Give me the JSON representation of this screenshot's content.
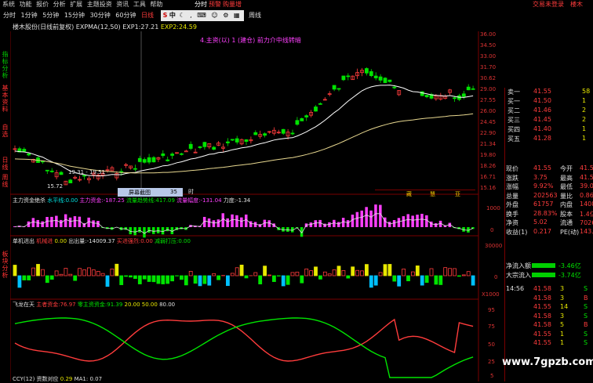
{
  "menubar": {
    "items": [
      "系统",
      "功能",
      "报价",
      "分析",
      "扩展",
      "主题投资",
      "资讯",
      "工具",
      "帮助"
    ],
    "center_items": [
      "分时",
      "预警",
      "购量增"
    ],
    "right_items": [
      "交易未登录",
      "楼木"
    ]
  },
  "toolbar": {
    "periods": [
      "分时",
      "1分钟",
      "5分钟",
      "15分钟",
      "30分钟",
      "60分钟",
      "日线",
      "周线"
    ],
    "ime": [
      "S",
      "中"
    ]
  },
  "left_tabs": [
    "指标分析",
    "基本资料",
    "自选",
    "日线",
    "周线",
    "板块分析"
  ],
  "header": {
    "title": "楼木股份(日线前复权)",
    "indicator": "EXPMA(12,50)",
    "exp1_label": "EXP1:",
    "exp1_value": "27.21",
    "exp2_label": "EXP2:",
    "exp2_value": "24.59",
    "note": "4.主资(以) 1 (建仓) 前力介中线转暗"
  },
  "price_axis": [
    "36.00",
    "34.50",
    "33.00",
    "31.70",
    "30.62",
    "29.00",
    "27.55",
    "26.00",
    "24.45",
    "22.90",
    "21.34",
    "19.80",
    "18.26",
    "16.71",
    "15.16"
  ],
  "price_labels": {
    "low": "15.72",
    "range": "19.31 - 19.51"
  },
  "tooltip": {
    "label": "屏幕截图",
    "value": "35",
    "extra": "时"
  },
  "strip_labels": [
    "藏",
    "慧",
    "亚"
  ],
  "panel2": {
    "title": "主力资金绝杀",
    "items": [
      {
        "label": "水平线:",
        "value": "0.00",
        "color": "#00e0e0"
      },
      {
        "label": "主力资金:",
        "value": "-187.25",
        "color": "#ff40ff"
      },
      {
        "label": "流量趋势线:",
        "value": "417.09",
        "color": "#00e400"
      },
      {
        "label": "流量幅度:",
        "value": "-131.04",
        "color": "#ff40ff"
      },
      {
        "label": "力度:",
        "value": "-1.34",
        "color": "#e0e0e0"
      }
    ],
    "axis": [
      "1000",
      "0"
    ]
  },
  "panel3": {
    "title": "单机进出",
    "items": [
      {
        "label": "机械进",
        "value": "",
        "color": "#ff3c3c"
      },
      {
        "label": "0.00",
        "value": "",
        "color": "#e8e800"
      },
      {
        "label": "出出量:",
        "value": "-14009.37",
        "color": "#ffffff"
      },
      {
        "label": "买进强烈:",
        "value": "0.00",
        "color": "#ff3c3c"
      },
      {
        "label": "减弱打压:",
        "value": "0.00",
        "color": "#00e400"
      }
    ],
    "axis": [
      "30000",
      "0",
      "X1000"
    ]
  },
  "panel4": {
    "title": "飞龙在天",
    "items": [
      {
        "label": "主者资金:",
        "value": "76.97",
        "color": "#ff3c3c"
      },
      {
        "label": "零主资资金:",
        "value": "91.39",
        "color": "#00e400"
      },
      {
        "label": "20.00",
        "value": "",
        "color": "#e8e800"
      },
      {
        "label": "50.00",
        "value": "",
        "color": "#e8e800"
      },
      {
        "label": "80.00",
        "value": "",
        "color": "#e0e0e0"
      }
    ],
    "axis": [
      "95",
      "75",
      "50",
      "25",
      "5"
    ]
  },
  "footer": {
    "left": "CCY(12) 资数对应",
    "v1": "0.29",
    "m1": "MA1: 0.07"
  },
  "quote": {
    "sell": [
      {
        "label": "卖一",
        "price": "41.55",
        "vol": "58"
      },
      {
        "label": "买一",
        "price": "41.50",
        "vol": "1"
      },
      {
        "label": "买二",
        "price": "41.46",
        "vol": "2"
      },
      {
        "label": "买三",
        "price": "41.45",
        "vol": "2"
      },
      {
        "label": "买四",
        "price": "41.40",
        "vol": "1"
      },
      {
        "label": "买五",
        "price": "41.28",
        "vol": "1"
      }
    ],
    "stats": [
      {
        "l1": "现价",
        "v1": "41.55",
        "l2": "今开",
        "v2": "41.50"
      },
      {
        "l1": "涨跌",
        "v1": "3.75",
        "l2": "最高",
        "v2": "41.55"
      },
      {
        "l1": "涨幅",
        "v1": "9.92%",
        "l2": "最低",
        "v2": "39.01"
      },
      {
        "l1": "总量",
        "v1": "202563",
        "l2": "量比",
        "v2": "0.86"
      },
      {
        "l1": "外盘",
        "v1": "61757",
        "l2": "内盘",
        "v2": "140806"
      },
      {
        "l1": "换手",
        "v1": "28.83%",
        "l2": "股本",
        "v2": "1.4亿"
      },
      {
        "l1": "净资",
        "v1": "5.02",
        "l2": "流通",
        "v2": "7026万"
      },
      {
        "l1": "收益(1)",
        "v1": "0.217",
        "l2": "PE(动)",
        "v2": "143.4"
      }
    ],
    "flows": [
      {
        "label": "净流入额",
        "value": "-3.46亿"
      },
      {
        "label": "大宗流入",
        "value": "-3.74亿"
      }
    ],
    "ticks": [
      {
        "time": "14:56",
        "price": "41.58",
        "vol": "3",
        "dir": "S"
      },
      {
        "time": "",
        "price": "41.58",
        "vol": "3",
        "dir": "B"
      },
      {
        "time": "",
        "price": "41.55",
        "vol": "14",
        "dir": "S"
      },
      {
        "time": "",
        "price": "41.58",
        "vol": "3",
        "dir": "S"
      },
      {
        "time": "",
        "price": "41.58",
        "vol": "5",
        "dir": "B"
      },
      {
        "time": "",
        "price": "41.55",
        "vol": "1",
        "dir": "S"
      },
      {
        "time": "",
        "price": "41.55",
        "vol": "1",
        "dir": "S"
      }
    ]
  },
  "watermark": "www.7gpzb.com",
  "colors": {
    "up": "#ff3c3c",
    "down": "#00e400",
    "grid": "#7a0000",
    "exp1": "#ffffff",
    "exp2": "#e8d890"
  }
}
